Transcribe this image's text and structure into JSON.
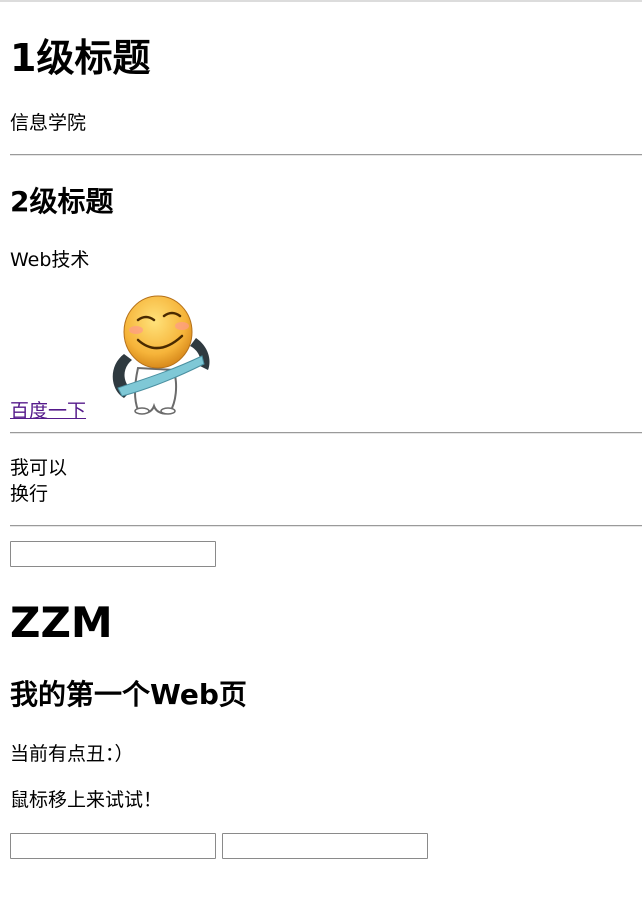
{
  "heading1": "1级标题",
  "para1": "信息学院",
  "heading2": "2级标题",
  "para2": "Web技术",
  "link_text": "百度一下",
  "image": {
    "icon": "smiley-emoticon",
    "description": ""
  },
  "break_text": {
    "line1": "我可以",
    "line2": "换行"
  },
  "input1": {
    "value": "",
    "placeholder": ""
  },
  "heading3": "ZZM",
  "heading4": "我的第一个Web页",
  "para3": "当前有点丑：）",
  "para4": "鼠标移上来试试！",
  "input2": {
    "value": "",
    "placeholder": ""
  },
  "input3": {
    "value": "",
    "placeholder": ""
  },
  "colors": {
    "link": "#551a8b",
    "rule": "#9a9a9a",
    "input_border": "#8a8a8a"
  }
}
